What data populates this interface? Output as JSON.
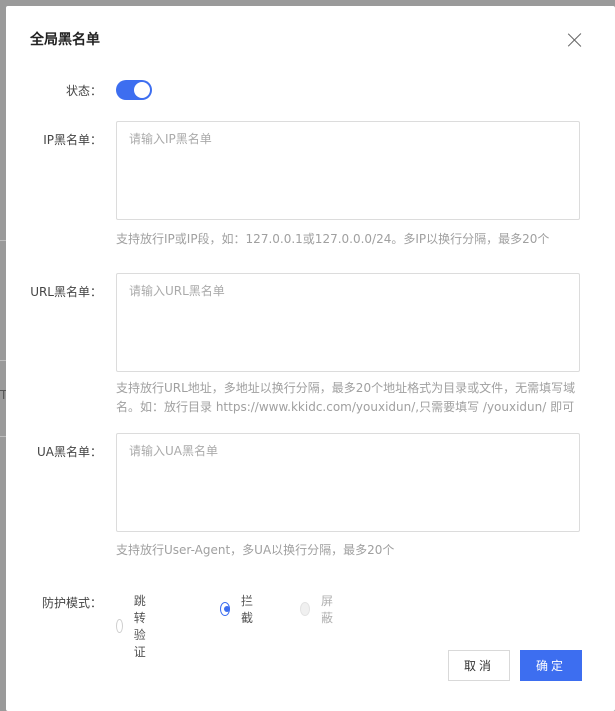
{
  "dialog": {
    "title": "全局黑名单",
    "close_icon": "close-icon"
  },
  "status": {
    "label": "状态：",
    "enabled": true
  },
  "ip_blacklist": {
    "label": "IP黑名单：",
    "placeholder": "请输入IP黑名单",
    "value": "",
    "hint": "支持放行IP或IP段，如：127.0.0.1或127.0.0.0/24。多IP以换行分隔，最多20个"
  },
  "url_blacklist": {
    "label": "URL黑名单：",
    "placeholder": "请输入URL黑名单",
    "value": "",
    "hint": "支持放行URL地址，多地址以换行分隔，最多20个地址格式为目录或文件，无需填写域名。如：放行目录 https://www.kkidc.com/youxidun/,只需要填写 /youxidun/ 即可"
  },
  "ua_blacklist": {
    "label": "UA黑名单：",
    "placeholder": "请输入UA黑名单",
    "value": "",
    "hint": "支持放行User-Agent，多UA以换行分隔，最多20个"
  },
  "protection_mode": {
    "label": "防护模式：",
    "options": [
      {
        "label": "跳转验证",
        "checked": false,
        "disabled": false
      },
      {
        "label": "拦截",
        "checked": true,
        "disabled": false
      },
      {
        "label": "屏蔽",
        "checked": false,
        "disabled": true
      }
    ]
  },
  "footer": {
    "cancel_label": "取消",
    "confirm_label": "确定"
  },
  "backdrop": {
    "fragment_text": "T,"
  },
  "colors": {
    "accent": "#3d6ef0",
    "hint": "#a0a0a0",
    "border": "#dcdcdc"
  }
}
